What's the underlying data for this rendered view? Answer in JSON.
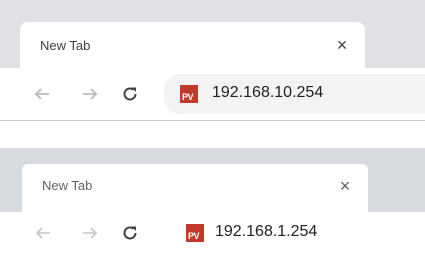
{
  "screens": [
    {
      "tab": {
        "title": "New Tab",
        "close_glyph": "×"
      },
      "toolbar": {
        "back_icon": "arrow-left-icon",
        "forward_icon": "arrow-right-icon",
        "reload_icon": "reload-icon"
      },
      "address_bar": {
        "url": "192.168.10.254",
        "site_icon_text": "PV"
      }
    },
    {
      "tab": {
        "title": "New Tab",
        "close_glyph": "×"
      },
      "toolbar": {
        "back_icon": "arrow-left-icon",
        "forward_icon": "arrow-right-icon",
        "reload_icon": "reload-icon"
      },
      "address_bar": {
        "url": "192.168.1.254",
        "site_icon_text": "PV"
      }
    }
  ],
  "colors": {
    "brand": "#c0392b",
    "tabstrip": "#dfe1e5",
    "omnibox": "#f1f3f4",
    "icon_disabled": "#b7b9bc",
    "icon_active": "#3c4043"
  }
}
